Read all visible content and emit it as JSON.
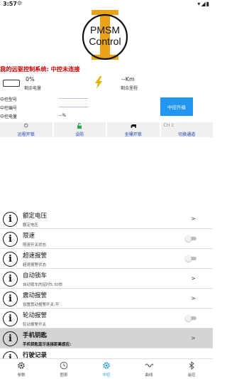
{
  "status_bar": {
    "time": "3:57",
    "signal": "▾◢▮"
  },
  "logo": {
    "line1": "PMSM",
    "line2": "Control"
  },
  "connection_status": "我的远驱控制系统: 中控未连接",
  "stats": {
    "battery_value": "0%",
    "battery_label": "剩余电量",
    "range_value": "--Km",
    "range_label": "剩余里程"
  },
  "info": [
    {
      "label": "中控型号",
      "value": "-------------------"
    },
    {
      "label": "中控编号",
      "value": "-------------------"
    },
    {
      "label": "中控电量",
      "value": "--%"
    }
  ],
  "upgrade_button": "中控升级",
  "controls": [
    {
      "icon": "power-icon",
      "label": "远程开锁"
    },
    {
      "icon": "lock-open-icon",
      "label": "设防"
    },
    {
      "icon": "seat-icon",
      "label": "坐桶开锁"
    },
    {
      "icon": "switch-icon",
      "label": "切换通道",
      "channel": "CH 1"
    }
  ],
  "settings": [
    {
      "title": "额定电压",
      "subtitle": "额定电压",
      "action": "chevron"
    },
    {
      "title": "限速",
      "subtitle": "限速开关状态",
      "action": "toggle",
      "toggle_on": false
    },
    {
      "title": "超速报警",
      "subtitle": "超速报警状态",
      "action": "toggle",
      "toggle_on": false
    },
    {
      "title": "自动锁车",
      "subtitle": "自动锁车的延时5:30秒",
      "action": "chevron"
    },
    {
      "title": "震动报警",
      "subtitle": "设置震动报警开关:开",
      "action": "chevron"
    },
    {
      "title": "轮动报警",
      "subtitle": "轮动报警开关",
      "action": "toggle",
      "toggle_on": false
    },
    {
      "title": "手机钥匙",
      "subtitle": "手机钥匙蓝牙连接距离感应:",
      "action": "chevron",
      "highlight": true
    },
    {
      "title": "行驶记录",
      "subtitle": "",
      "action": "none"
    }
  ],
  "tabs": [
    {
      "label": "参数",
      "icon": "gear-icon"
    },
    {
      "label": "图表",
      "icon": "clock-icon"
    },
    {
      "label": "中控",
      "icon": "gear-icon",
      "active": true
    },
    {
      "label": "曲线",
      "icon": "wave-icon"
    },
    {
      "label": "遥控",
      "icon": "bluetooth-icon"
    }
  ],
  "colors": {
    "accent": "#2196f3",
    "alert": "#d00000",
    "logo_gold": "#e8a317",
    "link": "#1a3fa0"
  }
}
